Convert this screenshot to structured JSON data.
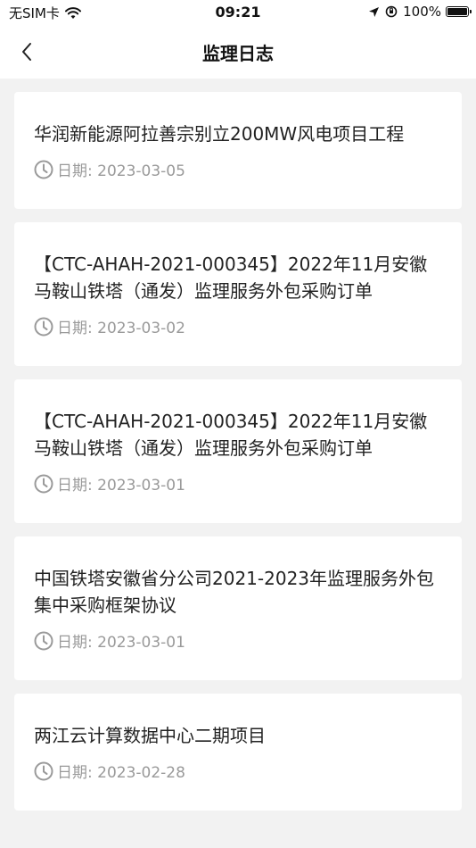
{
  "status_bar": {
    "carrier": "无SIM卡",
    "time": "09:21",
    "battery_percent": "100%"
  },
  "nav": {
    "title": "监理日志",
    "back_icon": "chevron-left-icon"
  },
  "logs": [
    {
      "title": "华润新能源阿拉善宗别立200MW风电项目工程",
      "date": "日期: 2023-03-05"
    },
    {
      "title": "【CTC-AHAH-2021-000345】2022年11月安徽马鞍山铁塔（通发）监理服务外包采购订单",
      "date": "日期: 2023-03-02"
    },
    {
      "title": "【CTC-AHAH-2021-000345】2022年11月安徽马鞍山铁塔（通发）监理服务外包采购订单",
      "date": "日期: 2023-03-01"
    },
    {
      "title": "中国铁塔安徽省分公司2021-2023年监理服务外包集中采购框架协议",
      "date": "日期: 2023-03-01"
    },
    {
      "title": "两江云计算数据中心二期项目",
      "date": "日期: 2023-02-28"
    }
  ]
}
